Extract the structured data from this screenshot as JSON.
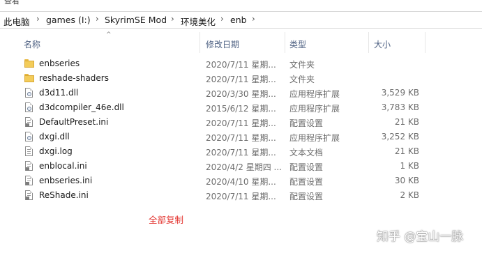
{
  "top_menu": {
    "label": "查看"
  },
  "breadcrumb": [
    "此电脑",
    "games (I:)",
    "SkyrimSE Mod",
    "环境美化",
    "enb"
  ],
  "columns": {
    "name": "名称",
    "modified": "修改日期",
    "type": "类型",
    "size": "大小"
  },
  "files": [
    {
      "name": "enbseries",
      "modified": "2020/7/11 星期...",
      "type": "文件夹",
      "size": "",
      "icon": "folder-icon"
    },
    {
      "name": "reshade-shaders",
      "modified": "2020/7/11 星期...",
      "type": "文件夹",
      "size": "",
      "icon": "folder-icon"
    },
    {
      "name": "d3d11.dll",
      "modified": "2020/3/30 星期...",
      "type": "应用程序扩展",
      "size": "3,529 KB",
      "icon": "dll-file-icon"
    },
    {
      "name": "d3dcompiler_46e.dll",
      "modified": "2015/6/12 星期...",
      "type": "应用程序扩展",
      "size": "3,783 KB",
      "icon": "dll-file-icon"
    },
    {
      "name": "DefaultPreset.ini",
      "modified": "2020/7/11 星期...",
      "type": "配置设置",
      "size": "21 KB",
      "icon": "ini-file-icon"
    },
    {
      "name": "dxgi.dll",
      "modified": "2020/7/11 星期...",
      "type": "应用程序扩展",
      "size": "3,252 KB",
      "icon": "dll-file-icon"
    },
    {
      "name": "dxgi.log",
      "modified": "2020/7/11 星期...",
      "type": "文本文档",
      "size": "21 KB",
      "icon": "text-file-icon"
    },
    {
      "name": "enblocal.ini",
      "modified": "2020/4/2 星期四 ...",
      "type": "配置设置",
      "size": "1 KB",
      "icon": "ini-file-icon"
    },
    {
      "name": "enbseries.ini",
      "modified": "2020/4/10 星期...",
      "type": "配置设置",
      "size": "30 KB",
      "icon": "ini-file-icon"
    },
    {
      "name": "ReShade.ini",
      "modified": "2020/7/11 星期...",
      "type": "配置设置",
      "size": "2 KB",
      "icon": "ini-file-icon"
    }
  ],
  "annotation": {
    "text": "全部复制"
  },
  "watermark": {
    "text": "知乎 @宝山一脉"
  }
}
